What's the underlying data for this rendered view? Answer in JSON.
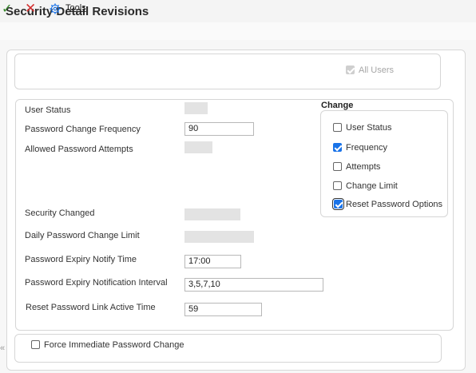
{
  "window": {
    "title": "Security Detail Revisions"
  },
  "toolbar": {
    "ok_icon": "check-icon",
    "cancel_icon": "close-icon",
    "tools_icon": "gear-icon",
    "tools_label": "Tools"
  },
  "top_panel": {
    "all_users_label": "All Users",
    "all_users_checked": true
  },
  "fields": {
    "user_status_label": "User Status",
    "password_change_frequency_label": "Password Change Frequency",
    "password_change_frequency_value": "90",
    "allowed_password_attempts_label": "Allowed Password Attempts",
    "security_changed_label": "Security Changed",
    "daily_password_change_limit_label": "Daily Password Change Limit",
    "password_expiry_notify_time_label": "Password Expiry Notify Time",
    "password_expiry_notify_time_value": "17:00",
    "password_expiry_notification_interval_label": "Password Expiry Notification Interval",
    "password_expiry_notification_interval_value": "3,5,7,10",
    "reset_password_link_active_time_label": "Reset Password Link Active Time",
    "reset_password_link_active_time_value": "59"
  },
  "change_group": {
    "title": "Change",
    "options": [
      {
        "label": "User Status",
        "checked": false
      },
      {
        "label": "Frequency",
        "checked": true
      },
      {
        "label": "Attempts",
        "checked": false
      },
      {
        "label": "Change Limit",
        "checked": false
      },
      {
        "label": "Reset Password Options",
        "checked": true
      }
    ]
  },
  "bottom_panel": {
    "force_change_label": "Force Immediate Password Change",
    "force_change_checked": false
  },
  "colors": {
    "check": "#3a8a2e",
    "cancel": "#d32f2f",
    "accent": "#1a73e8"
  }
}
